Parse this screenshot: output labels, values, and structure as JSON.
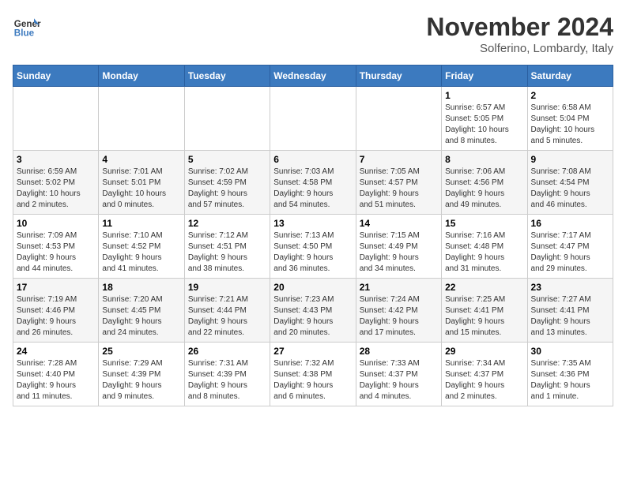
{
  "header": {
    "logo_line1": "General",
    "logo_line2": "Blue",
    "title": "November 2024",
    "subtitle": "Solferino, Lombardy, Italy"
  },
  "weekdays": [
    "Sunday",
    "Monday",
    "Tuesday",
    "Wednesday",
    "Thursday",
    "Friday",
    "Saturday"
  ],
  "weeks": [
    [
      {
        "day": "",
        "info": ""
      },
      {
        "day": "",
        "info": ""
      },
      {
        "day": "",
        "info": ""
      },
      {
        "day": "",
        "info": ""
      },
      {
        "day": "",
        "info": ""
      },
      {
        "day": "1",
        "info": "Sunrise: 6:57 AM\nSunset: 5:05 PM\nDaylight: 10 hours\nand 8 minutes."
      },
      {
        "day": "2",
        "info": "Sunrise: 6:58 AM\nSunset: 5:04 PM\nDaylight: 10 hours\nand 5 minutes."
      }
    ],
    [
      {
        "day": "3",
        "info": "Sunrise: 6:59 AM\nSunset: 5:02 PM\nDaylight: 10 hours\nand 2 minutes."
      },
      {
        "day": "4",
        "info": "Sunrise: 7:01 AM\nSunset: 5:01 PM\nDaylight: 10 hours\nand 0 minutes."
      },
      {
        "day": "5",
        "info": "Sunrise: 7:02 AM\nSunset: 4:59 PM\nDaylight: 9 hours\nand 57 minutes."
      },
      {
        "day": "6",
        "info": "Sunrise: 7:03 AM\nSunset: 4:58 PM\nDaylight: 9 hours\nand 54 minutes."
      },
      {
        "day": "7",
        "info": "Sunrise: 7:05 AM\nSunset: 4:57 PM\nDaylight: 9 hours\nand 51 minutes."
      },
      {
        "day": "8",
        "info": "Sunrise: 7:06 AM\nSunset: 4:56 PM\nDaylight: 9 hours\nand 49 minutes."
      },
      {
        "day": "9",
        "info": "Sunrise: 7:08 AM\nSunset: 4:54 PM\nDaylight: 9 hours\nand 46 minutes."
      }
    ],
    [
      {
        "day": "10",
        "info": "Sunrise: 7:09 AM\nSunset: 4:53 PM\nDaylight: 9 hours\nand 44 minutes."
      },
      {
        "day": "11",
        "info": "Sunrise: 7:10 AM\nSunset: 4:52 PM\nDaylight: 9 hours\nand 41 minutes."
      },
      {
        "day": "12",
        "info": "Sunrise: 7:12 AM\nSunset: 4:51 PM\nDaylight: 9 hours\nand 38 minutes."
      },
      {
        "day": "13",
        "info": "Sunrise: 7:13 AM\nSunset: 4:50 PM\nDaylight: 9 hours\nand 36 minutes."
      },
      {
        "day": "14",
        "info": "Sunrise: 7:15 AM\nSunset: 4:49 PM\nDaylight: 9 hours\nand 34 minutes."
      },
      {
        "day": "15",
        "info": "Sunrise: 7:16 AM\nSunset: 4:48 PM\nDaylight: 9 hours\nand 31 minutes."
      },
      {
        "day": "16",
        "info": "Sunrise: 7:17 AM\nSunset: 4:47 PM\nDaylight: 9 hours\nand 29 minutes."
      }
    ],
    [
      {
        "day": "17",
        "info": "Sunrise: 7:19 AM\nSunset: 4:46 PM\nDaylight: 9 hours\nand 26 minutes."
      },
      {
        "day": "18",
        "info": "Sunrise: 7:20 AM\nSunset: 4:45 PM\nDaylight: 9 hours\nand 24 minutes."
      },
      {
        "day": "19",
        "info": "Sunrise: 7:21 AM\nSunset: 4:44 PM\nDaylight: 9 hours\nand 22 minutes."
      },
      {
        "day": "20",
        "info": "Sunrise: 7:23 AM\nSunset: 4:43 PM\nDaylight: 9 hours\nand 20 minutes."
      },
      {
        "day": "21",
        "info": "Sunrise: 7:24 AM\nSunset: 4:42 PM\nDaylight: 9 hours\nand 17 minutes."
      },
      {
        "day": "22",
        "info": "Sunrise: 7:25 AM\nSunset: 4:41 PM\nDaylight: 9 hours\nand 15 minutes."
      },
      {
        "day": "23",
        "info": "Sunrise: 7:27 AM\nSunset: 4:41 PM\nDaylight: 9 hours\nand 13 minutes."
      }
    ],
    [
      {
        "day": "24",
        "info": "Sunrise: 7:28 AM\nSunset: 4:40 PM\nDaylight: 9 hours\nand 11 minutes."
      },
      {
        "day": "25",
        "info": "Sunrise: 7:29 AM\nSunset: 4:39 PM\nDaylight: 9 hours\nand 9 minutes."
      },
      {
        "day": "26",
        "info": "Sunrise: 7:31 AM\nSunset: 4:39 PM\nDaylight: 9 hours\nand 8 minutes."
      },
      {
        "day": "27",
        "info": "Sunrise: 7:32 AM\nSunset: 4:38 PM\nDaylight: 9 hours\nand 6 minutes."
      },
      {
        "day": "28",
        "info": "Sunrise: 7:33 AM\nSunset: 4:37 PM\nDaylight: 9 hours\nand 4 minutes."
      },
      {
        "day": "29",
        "info": "Sunrise: 7:34 AM\nSunset: 4:37 PM\nDaylight: 9 hours\nand 2 minutes."
      },
      {
        "day": "30",
        "info": "Sunrise: 7:35 AM\nSunset: 4:36 PM\nDaylight: 9 hours\nand 1 minute."
      }
    ]
  ]
}
